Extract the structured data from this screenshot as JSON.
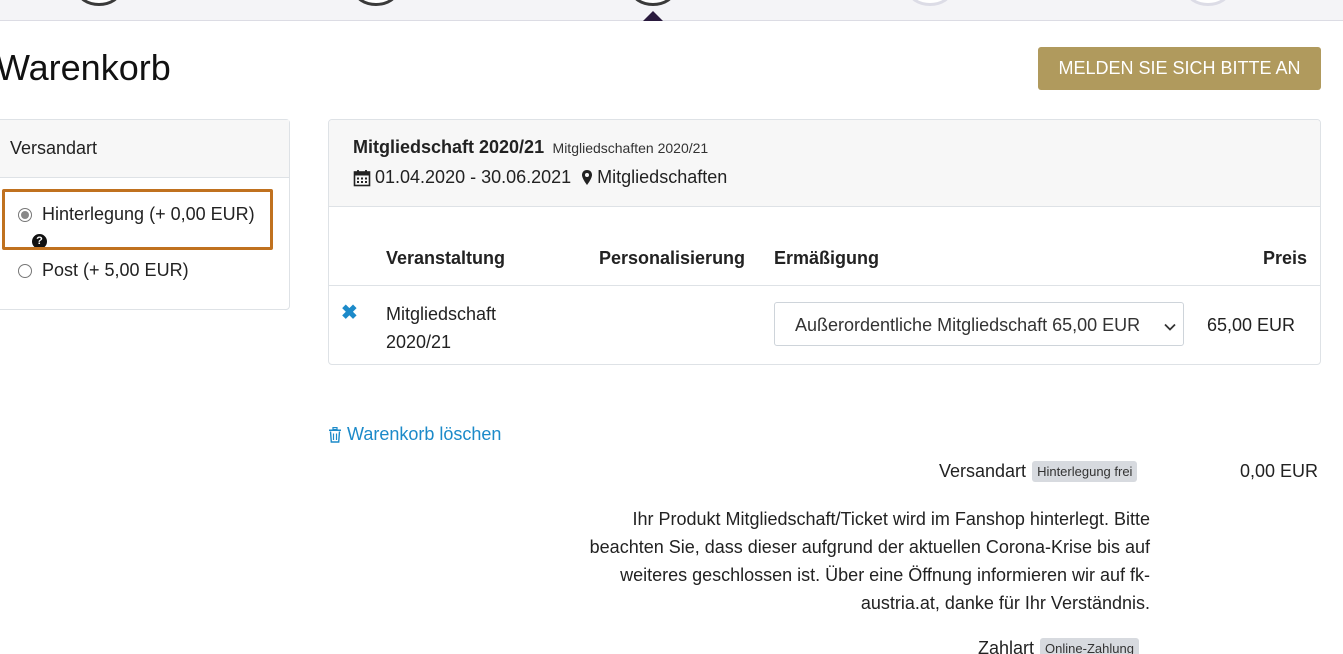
{
  "header": {
    "title": "Warenkorb",
    "login_label": "MELDEN SIE SICH BITTE AN"
  },
  "shipping_panel": {
    "title": "Versandart",
    "options": [
      {
        "label": "Hinterlegung (+ 0,00 EUR)",
        "selected": true
      },
      {
        "label": "Post (+ 5,00 EUR)",
        "selected": false
      }
    ],
    "help_glyph": "?"
  },
  "product": {
    "title": "Mitgliedschaft 2020/21",
    "subtitle": "Mitgliedschaften 2020/21",
    "date_range": "01.04.2020 - 30.06.2021",
    "location": "Mitgliedschaften",
    "columns": [
      "Veranstaltung",
      "Personalisierung",
      "Ermäßigung",
      "Preis"
    ],
    "row": {
      "remove_glyph": "✖",
      "name": "Mitgliedschaft 2020/21",
      "discount_selected": "Außerordentliche Mitgliedschaft 65,00 EUR",
      "price": "65,00 EUR"
    }
  },
  "cart": {
    "clear_label": "Warenkorb löschen"
  },
  "summary": {
    "shipping_label": "Versandart",
    "shipping_badge": "Hinterlegung frei",
    "shipping_value": "0,00 EUR",
    "info": "Ihr Produkt Mitgliedschaft/Ticket wird im Fanshop hinterlegt. Bitte beachten Sie, dass dieser aufgrund der aktuellen Corona-Krise bis auf weiteres geschlossen ist. Über eine Öffnung informieren wir auf fk-austria.at, danke für Ihr Verständnis.",
    "payment_label": "Zahlart",
    "payment_badge": "Online-Zahlung"
  },
  "colors": {
    "accent_gold": "#b09a5d",
    "link_blue": "#1c8ac9",
    "highlight_orange": "#c0711f"
  }
}
